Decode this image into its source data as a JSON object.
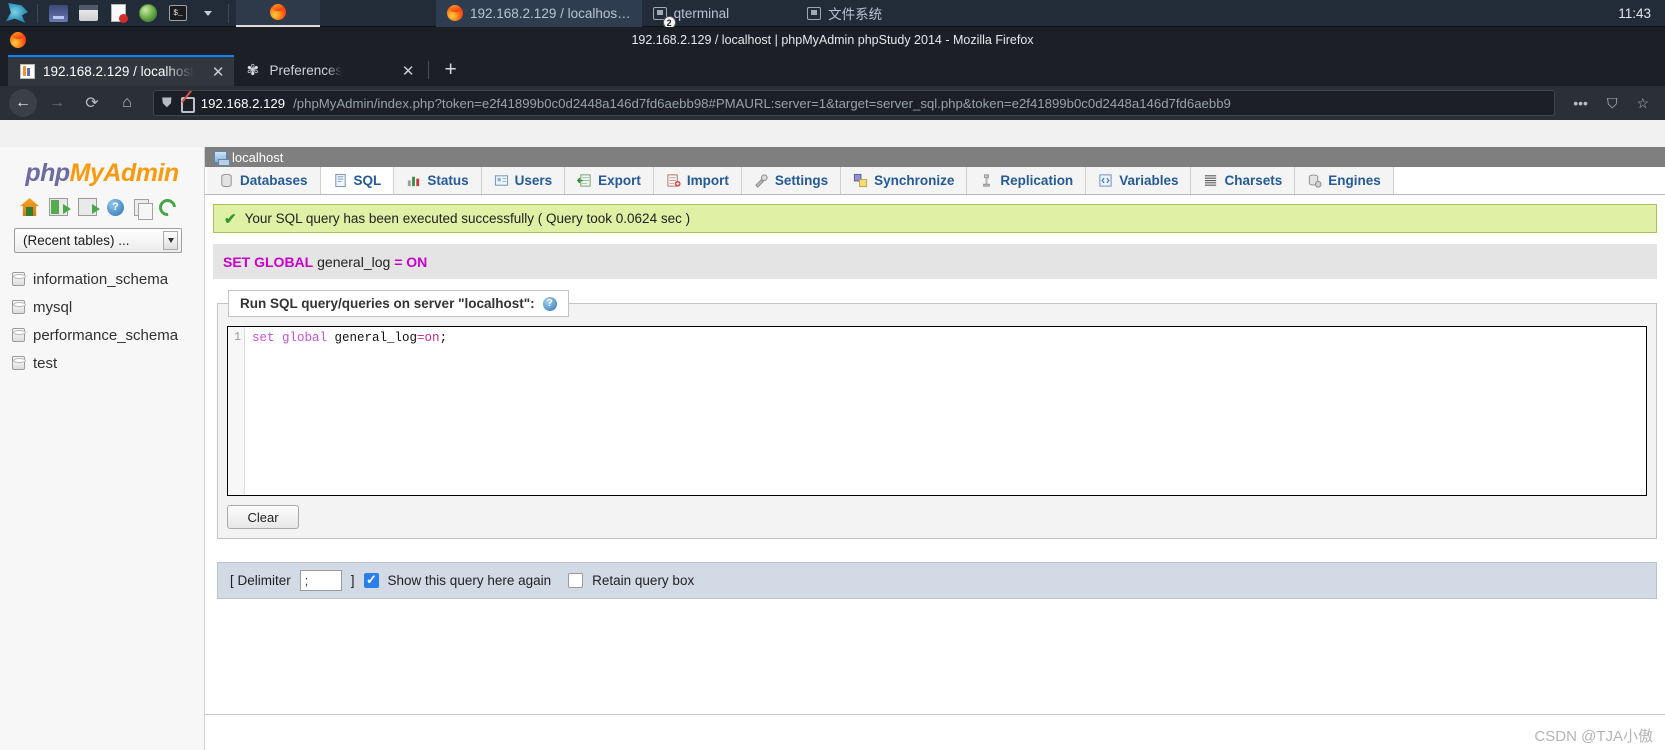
{
  "taskbar": {
    "launchers": [
      {
        "name": "kali-dragon-menu",
        "icon": "dragon-icon"
      },
      {
        "name": "app-blue",
        "icon": "square-blue-icon"
      },
      {
        "name": "file-manager",
        "icon": "folder-icon"
      },
      {
        "name": "text-editor",
        "icon": "document-icon"
      },
      {
        "name": "browser-globe",
        "icon": "globe-icon"
      },
      {
        "name": "terminal",
        "icon": "terminal-icon"
      },
      {
        "name": "more-apps",
        "icon": "chevron-down-icon"
      }
    ],
    "windows": [
      {
        "label": "192.168.2.129 / localhos…",
        "icon": "firefox-icon",
        "badge": "",
        "active": true
      },
      {
        "label": "qterminal",
        "icon": "monitor-icon",
        "badge": "2",
        "active": false
      },
      {
        "label": "文件系统",
        "icon": "monitor-icon",
        "badge": "",
        "active": false
      }
    ],
    "clock": "11:43"
  },
  "browser": {
    "window_title": "192.168.2.129 / localhost | phpMyAdmin phpStudy 2014 - Mozilla Firefox",
    "tabs": [
      {
        "label": "192.168.2.129 / localhost",
        "icon": "phpmyadmin-favicon",
        "active": true,
        "close": "✕"
      },
      {
        "label": "Preferences",
        "icon": "gear-icon",
        "active": false,
        "close": "✕"
      }
    ],
    "new_tab_label": "+",
    "nav": {
      "back": "←",
      "forward": "→",
      "reload": "⟳",
      "home": "⌂",
      "page_actions": "•••",
      "pocket": "⛉",
      "bookmark": "☆"
    },
    "url_host": "192.168.2.129",
    "url_rest": "/phpMyAdmin/index.php?token=e2f41899b0c0d2448a146d7fd6aebb98#PMAURL:server=1&target=server_sql.php&token=e2f41899b0c0d2448a146d7fd6aebb9"
  },
  "sidebar": {
    "logo_php": "php",
    "logo_myadmin": "MyAdmin",
    "icons": [
      {
        "name": "home-icon",
        "title": "Home"
      },
      {
        "name": "logout-icon",
        "title": "Log out"
      },
      {
        "name": "open-new-window-icon",
        "title": "Open new phpMyAdmin window"
      },
      {
        "name": "help-icon",
        "title": "Documentation"
      },
      {
        "name": "copy-icon",
        "title": "phpMyAdmin wiki"
      },
      {
        "name": "reload-icon",
        "title": "Reload navigation"
      }
    ],
    "recent_tables_label": "(Recent tables) ...",
    "databases": [
      "information_schema",
      "mysql",
      "performance_schema",
      "test"
    ]
  },
  "main": {
    "server_bar_label": "localhost",
    "tabs": [
      {
        "label": "Databases",
        "icon": "database-icon",
        "active": false
      },
      {
        "label": "SQL",
        "icon": "sql-icon",
        "active": true
      },
      {
        "label": "Status",
        "icon": "status-icon",
        "active": false
      },
      {
        "label": "Users",
        "icon": "users-icon",
        "active": false
      },
      {
        "label": "Export",
        "icon": "export-icon",
        "active": false
      },
      {
        "label": "Import",
        "icon": "import-icon",
        "active": false
      },
      {
        "label": "Settings",
        "icon": "settings-icon",
        "active": false
      },
      {
        "label": "Synchronize",
        "icon": "synchronize-icon",
        "active": false
      },
      {
        "label": "Replication",
        "icon": "replication-icon",
        "active": false
      },
      {
        "label": "Variables",
        "icon": "variables-icon",
        "active": false
      },
      {
        "label": "Charsets",
        "icon": "charsets-icon",
        "active": false
      },
      {
        "label": "Engines",
        "icon": "engines-icon",
        "active": false
      }
    ],
    "success_message": "Your SQL query has been executed successfully ( Query took 0.0624 sec )",
    "executed_sql": {
      "kw1": "SET GLOBAL",
      "identifier": "general_log",
      "operator": "=",
      "value": "ON"
    },
    "query_panel": {
      "legend": "Run SQL query/queries on server \"localhost\":",
      "help_icon_label": "?",
      "line_number": "1",
      "code_kw": "set global",
      "code_id": " general_log",
      "code_op": "=",
      "code_val": "on",
      "code_pun": ";",
      "clear_button": "Clear"
    },
    "delimiter_bar": {
      "open_bracket": "[ Delimiter",
      "delimiter_value": ";",
      "close_bracket": "]",
      "show_query_label": "Show this query here again",
      "show_query_checked": true,
      "retain_query_label": "Retain query box",
      "retain_query_checked": false
    }
  },
  "watermark": "CSDN @TJA小傲",
  "colors": {
    "taskbar_bg": "#222b38",
    "firefox_chrome": "#1c2026",
    "accent_blue": "#0a84ff",
    "pma_orange": "#f89a0e",
    "pma_purple": "#6c6ca0",
    "success_bg": "#e0f0a5",
    "success_border": "#a5c162",
    "sql_keyword": "#cc00cc",
    "tab_link": "#235a97",
    "delimiter_bar_bg": "#d2dbe5"
  }
}
